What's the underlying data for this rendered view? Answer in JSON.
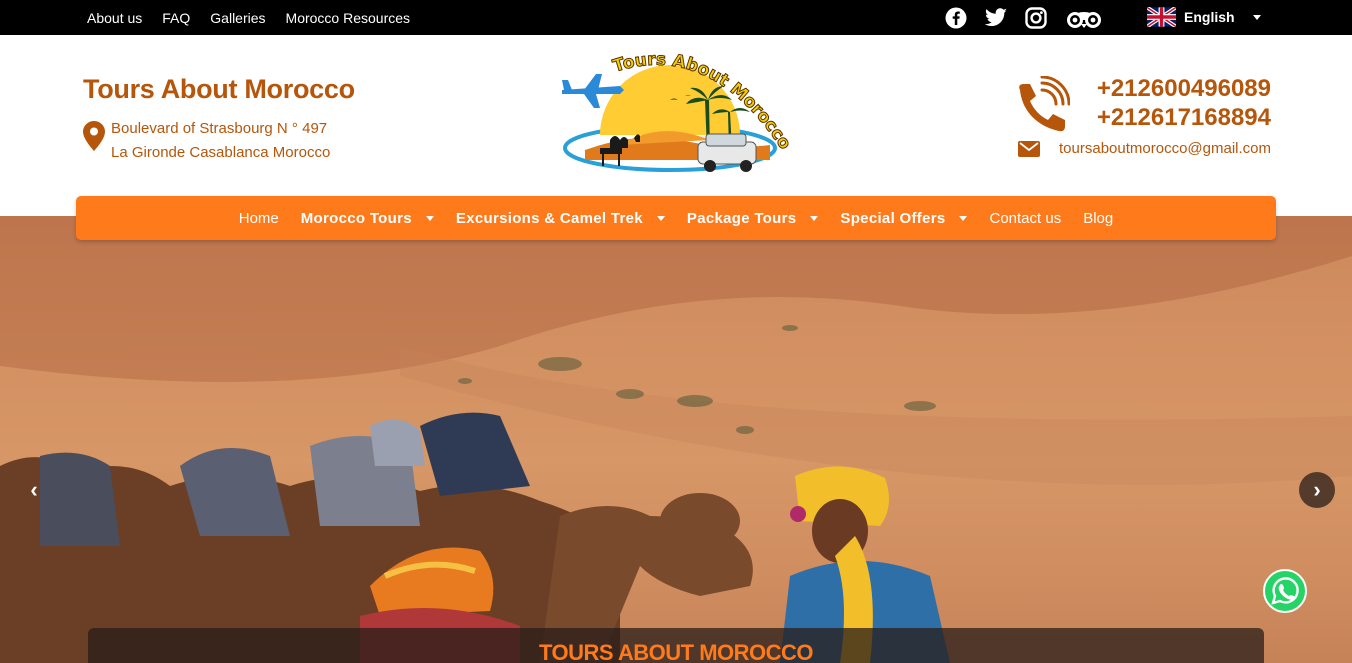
{
  "topbar": {
    "links": [
      "About us",
      "FAQ",
      "Galleries",
      "Morocco Resources"
    ],
    "socials": [
      "facebook-icon",
      "twitter-icon",
      "instagram-icon",
      "tripadvisor-icon"
    ],
    "language": "English"
  },
  "header": {
    "brand": "Tours About Morocco",
    "address_line1": "Boulevard of Strasbourg N ° 497",
    "address_line2": "La Gironde Casablanca Morocco",
    "logo_text": "Tours About Morocco",
    "phone1": "+212600496089",
    "phone2": "+212617168894",
    "email": "toursaboutmorocco@gmail.com"
  },
  "nav": {
    "home": "Home",
    "morocco_tours": "Morocco Tours",
    "excursions": "Excursions & Camel Trek",
    "package_tours": "Package Tours",
    "special_offers": "Special Offers",
    "contact": "Contact us",
    "blog": "Blog"
  },
  "hero": {
    "caption": "TOURS ABOUT MOROCCO",
    "prev": "‹",
    "next": "›"
  },
  "colors": {
    "accent": "#ff7a1a",
    "brand": "#b5560b",
    "topbar": "#000000"
  }
}
